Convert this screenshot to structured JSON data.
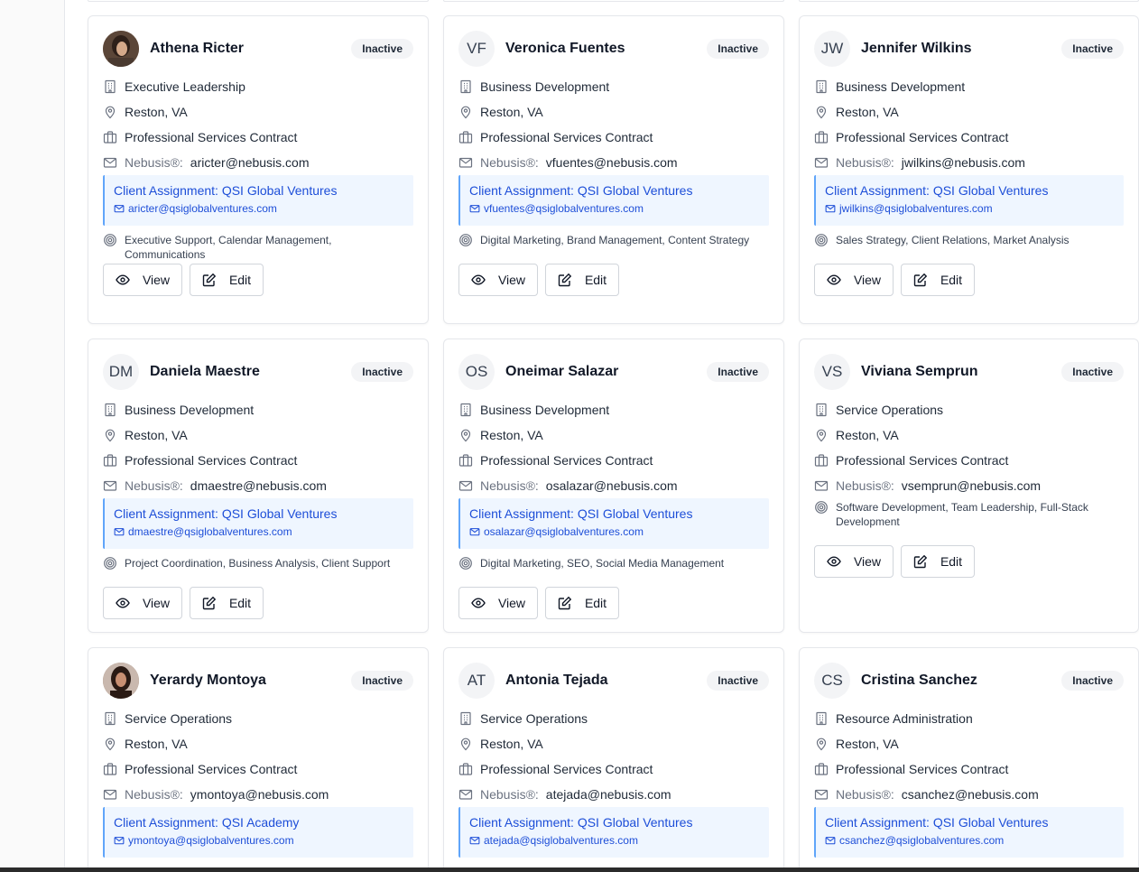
{
  "prefix_label": "Nebusis®:",
  "status_label": "Inactive",
  "view_label": "View",
  "edit_label": "Edit",
  "cards": [
    {
      "initials": "",
      "name": "Athena Ricter",
      "department": "Executive Leadership",
      "location": "Reston, VA",
      "contract": "Professional Services Contract",
      "email": "aricter@nebusis.com",
      "assignment": "Client Assignment: QSI Global Ventures",
      "assignment_email": "aricter@qsiglobalventures.com",
      "skills": "Executive Support, Calendar Management, Communications"
    },
    {
      "initials": "VF",
      "name": "Veronica Fuentes",
      "department": "Business Development",
      "location": "Reston, VA",
      "contract": "Professional Services Contract",
      "email": "vfuentes@nebusis.com",
      "assignment": "Client Assignment: QSI Global Ventures",
      "assignment_email": "vfuentes@qsiglobalventures.com",
      "skills": "Digital Marketing, Brand Management, Content Strategy"
    },
    {
      "initials": "JW",
      "name": "Jennifer Wilkins",
      "department": "Business Development",
      "location": "Reston, VA",
      "contract": "Professional Services Contract",
      "email": "jwilkins@nebusis.com",
      "assignment": "Client Assignment: QSI Global Ventures",
      "assignment_email": "jwilkins@qsiglobalventures.com",
      "skills": "Sales Strategy, Client Relations, Market Analysis"
    },
    {
      "initials": "DM",
      "name": "Daniela Maestre",
      "department": "Business Development",
      "location": "Reston, VA",
      "contract": "Professional Services Contract",
      "email": "dmaestre@nebusis.com",
      "assignment": "Client Assignment: QSI Global Ventures",
      "assignment_email": "dmaestre@qsiglobalventures.com",
      "skills": "Project Coordination, Business Analysis, Client Support"
    },
    {
      "initials": "OS",
      "name": "Oneimar Salazar",
      "department": "Business Development",
      "location": "Reston, VA",
      "contract": "Professional Services Contract",
      "email": "osalazar@nebusis.com",
      "assignment": "Client Assignment: QSI Global Ventures",
      "assignment_email": "osalazar@qsiglobalventures.com",
      "skills": "Digital Marketing, SEO, Social Media Management"
    },
    {
      "initials": "VS",
      "name": "Viviana Semprun",
      "department": "Service Operations",
      "location": "Reston, VA",
      "contract": "Professional Services Contract",
      "email": "vsemprun@nebusis.com",
      "assignment": "",
      "assignment_email": "",
      "skills": "Software Development, Team Leadership, Full-Stack Development"
    },
    {
      "initials": "",
      "name": "Yerardy Montoya",
      "department": "Service Operations",
      "location": "Reston, VA",
      "contract": "Professional Services Contract",
      "email": "ymontoya@nebusis.com",
      "assignment": "Client Assignment: QSI Academy",
      "assignment_email": "ymontoya@qsiglobalventures.com",
      "skills": ""
    },
    {
      "initials": "AT",
      "name": "Antonia Tejada",
      "department": "Service Operations",
      "location": "Reston, VA",
      "contract": "Professional Services Contract",
      "email": "atejada@nebusis.com",
      "assignment": "Client Assignment: QSI Global Ventures",
      "assignment_email": "atejada@qsiglobalventures.com",
      "skills": ""
    },
    {
      "initials": "CS",
      "name": "Cristina Sanchez",
      "department": "Resource Administration",
      "location": "Reston, VA",
      "contract": "Professional Services Contract",
      "email": "csanchez@nebusis.com",
      "assignment": "Client Assignment: QSI Global Ventures",
      "assignment_email": "csanchez@qsiglobalventures.com",
      "skills": ""
    }
  ]
}
